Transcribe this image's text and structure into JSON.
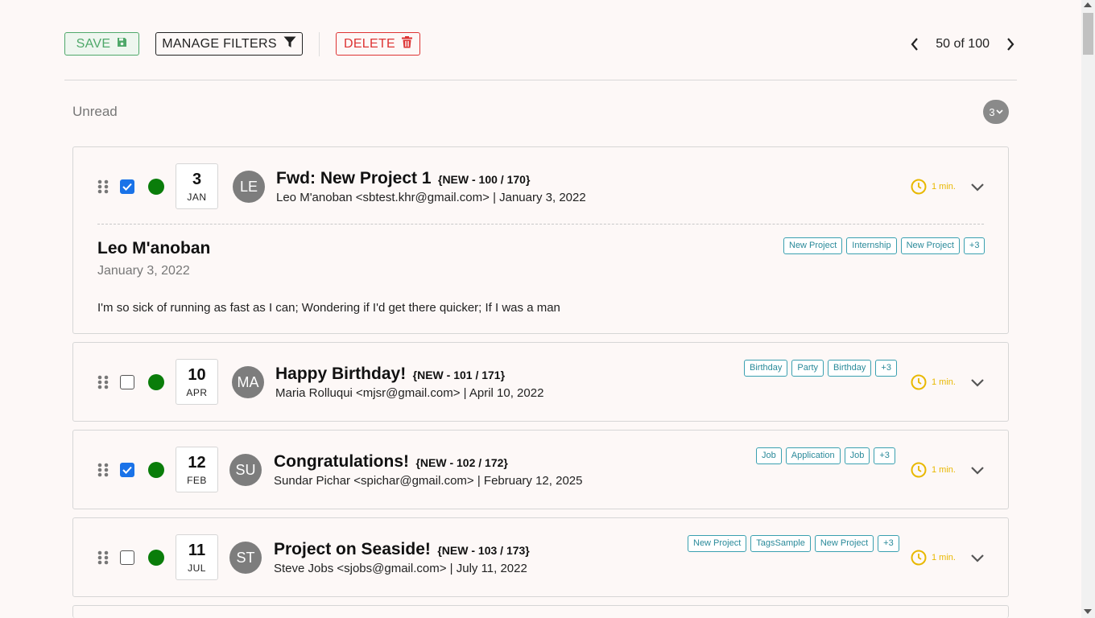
{
  "toolbar": {
    "save_label": "SAVE",
    "filters_label": "MANAGE FILTERS",
    "delete_label": "DELETE"
  },
  "pager": {
    "text": "50 of 100"
  },
  "section": {
    "title": "Unread",
    "count": "3"
  },
  "colors": {
    "save": "#4fa86a",
    "delete": "#dd3333",
    "status_dot": "#0a7d0a",
    "tag": "#3aa0b0",
    "timer": "#e8b800",
    "checkbox_on": "#1a73e8",
    "avatar": "#7d7d7d"
  },
  "emails": [
    {
      "checked": true,
      "day": "3",
      "month": "JAN",
      "initials": "LE",
      "subject": "Fwd: New Project 1",
      "num": "{NEW - 100 / 170}",
      "from": "Leo M'anoban <sbtest.khr@gmail.com> | January 3, 2022",
      "tags": [
        "New Project",
        "Internship",
        "New Project",
        "+3"
      ],
      "time": "1 min.",
      "expanded": true,
      "sender": "Leo M'anoban",
      "date": "January 3, 2022",
      "body": "I'm so sick of running as fast as I can; Wondering if I'd get there quicker; If I was a man"
    },
    {
      "checked": false,
      "day": "10",
      "month": "APR",
      "initials": "MA",
      "subject": "Happy Birthday!",
      "num": "{NEW - 101 / 171}",
      "from": "Maria Rolluqui <mjsr@gmail.com> | April 10, 2022",
      "tags": [
        "Birthday",
        "Party",
        "Birthday",
        "+3"
      ],
      "time": "1 min."
    },
    {
      "checked": true,
      "day": "12",
      "month": "FEB",
      "initials": "SU",
      "subject": "Congratulations!",
      "num": "{NEW - 102 / 172}",
      "from": "Sundar Pichar <spichar@gmail.com> | February 12, 2025",
      "tags": [
        "Job",
        "Application",
        "Job",
        "+3"
      ],
      "time": "1 min."
    },
    {
      "checked": false,
      "day": "11",
      "month": "JUL",
      "initials": "ST",
      "subject": "Project on Seaside!",
      "num": "{NEW - 103 / 173}",
      "from": "Steve Jobs <sjobs@gmail.com> | July 11, 2022",
      "tags": [
        "New Project",
        "TagsSample",
        "New Project",
        "+3"
      ],
      "time": "1 min."
    }
  ]
}
